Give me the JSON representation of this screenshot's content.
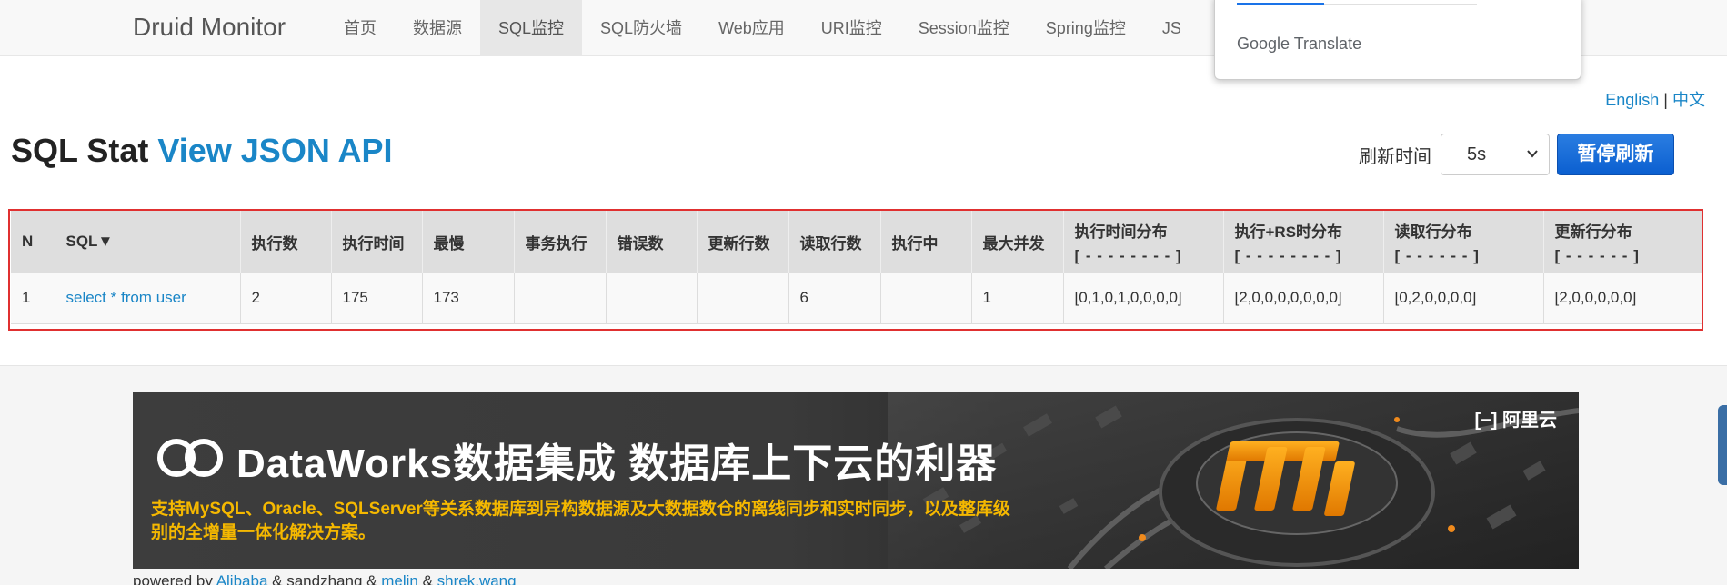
{
  "brand": "Druid Monitor",
  "nav": [
    "首页",
    "数据源",
    "SQL监控",
    "SQL防火墙",
    "Web应用",
    "URI监控",
    "Session监控",
    "Spring监控",
    "JS"
  ],
  "nav_active": 2,
  "translate_popup": {
    "brand": "Google Translate"
  },
  "lang": {
    "english": "English",
    "sep": "|",
    "chinese": "中文"
  },
  "heading": {
    "title": "SQL Stat",
    "api_link": "View JSON API"
  },
  "refresh": {
    "label": "刷新时间",
    "value": "5s",
    "pause_label": "暂停刷新"
  },
  "table": {
    "headers": [
      {
        "label": "N"
      },
      {
        "label": "SQL▼"
      },
      {
        "label": "执行数"
      },
      {
        "label": "执行时间"
      },
      {
        "label": "最慢"
      },
      {
        "label": "事务执行"
      },
      {
        "label": "错误数"
      },
      {
        "label": "更新行数"
      },
      {
        "label": "读取行数"
      },
      {
        "label": "执行中"
      },
      {
        "label": "最大并发"
      },
      {
        "label": "执行时间分布",
        "sub": "[ - - - - - - - - ]"
      },
      {
        "label": "执行+RS时分布",
        "sub": "[ - - - - - - - - ]"
      },
      {
        "label": "读取行分布",
        "sub": "[ - - - - - - ]"
      },
      {
        "label": "更新行分布",
        "sub": "[ - - - - - - ]"
      }
    ],
    "rows": [
      [
        "1",
        "select * from user",
        "2",
        "175",
        "173",
        "",
        "",
        "",
        "6",
        "",
        "1",
        "[0,1,0,1,0,0,0,0]",
        "[2,0,0,0,0,0,0,0]",
        "[0,2,0,0,0,0]",
        "[2,0,0,0,0,0]"
      ]
    ]
  },
  "banner": {
    "title": "DataWorks数据集成 数据库上下云的利器",
    "subtitle": "支持MySQL、Oracle、SQLServer等关系数据库到异构数据源及大数据数仓的离线同步和实时同步，以及整库级别的全增量一体化解决方案。",
    "aliyun": "阿里云",
    "title_color": "#ffffff",
    "subtitle_color": "#f5b800"
  },
  "footer": {
    "powered_by": "powered by",
    "links": [
      "Alibaba",
      "sandzhang",
      "melin",
      "shrek.wang"
    ],
    "separator": "&"
  },
  "colors": {
    "link": "#1a86c7",
    "highlight_box": "#e03030",
    "button": "#0b5fd0"
  }
}
